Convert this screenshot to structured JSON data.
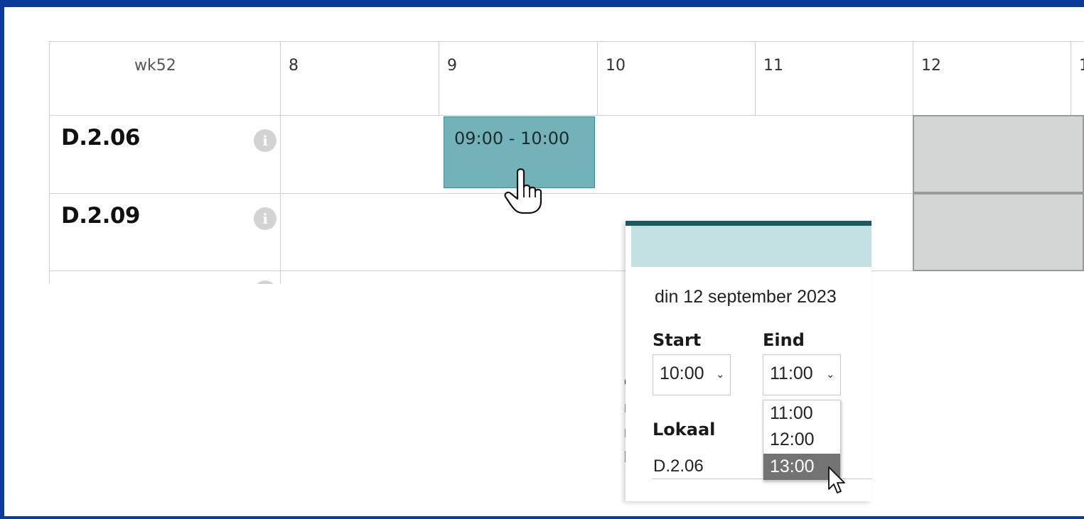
{
  "schedule": {
    "week_label": "wk52",
    "hours": [
      "8",
      "9",
      "10",
      "11",
      "12",
      "1"
    ],
    "rooms": [
      {
        "name": "D.2.06",
        "info_icon": "info-icon"
      },
      {
        "name": "D.2.09",
        "info_icon": "info-icon"
      }
    ],
    "booking": {
      "time_label": "09:00 - 10:00",
      "color": "#72b2b8"
    },
    "blocked_color": "#d4d5d5"
  },
  "popup": {
    "date": "din 12 september 2023",
    "start_label": "Start",
    "start_value": "10:00",
    "end_label": "Eind",
    "end_value": "11:00",
    "room_label": "Lokaal",
    "room_value": "D.2.06",
    "header_color": "#c3e1e2",
    "bar_color": "#1a5a60"
  },
  "end_dropdown": {
    "options": [
      "11:00",
      "12:00",
      "13:00"
    ],
    "highlighted": "13:00"
  },
  "background_text_fragments": [
    "e",
    "n",
    "n",
    "le"
  ],
  "frame_color": "#0a3a9a"
}
